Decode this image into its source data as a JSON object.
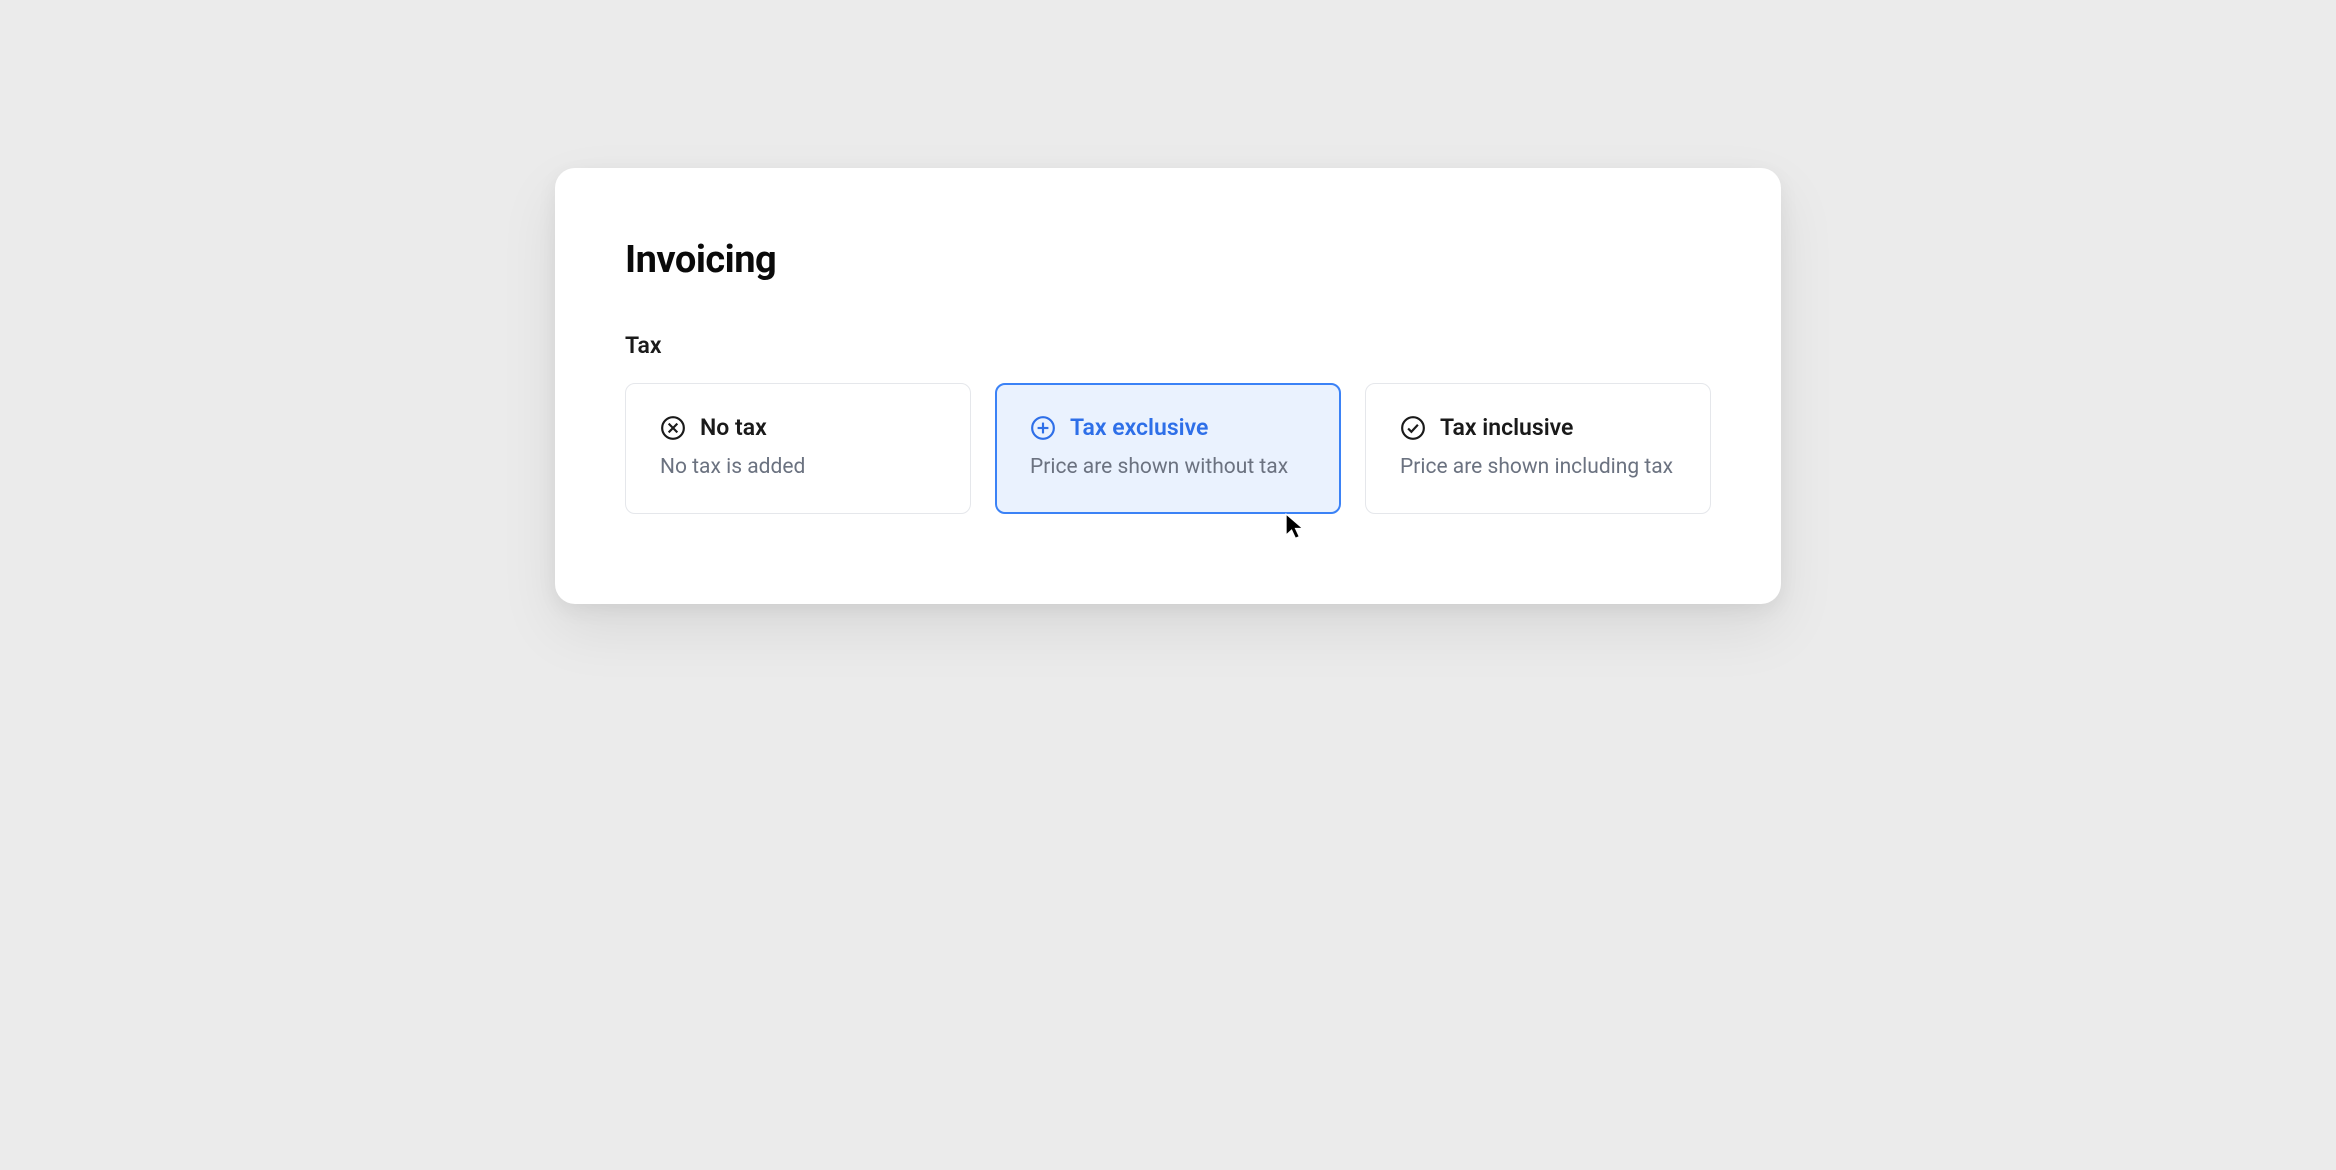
{
  "page": {
    "title": "Invoicing"
  },
  "tax": {
    "section_title": "Tax",
    "selected": 1,
    "options": [
      {
        "icon": "cross-circle",
        "title": "No tax",
        "description": "No tax is added"
      },
      {
        "icon": "plus-circle",
        "title": "Tax exclusive",
        "description": "Price are shown without tax"
      },
      {
        "icon": "check-circle",
        "title": "Tax inclusive",
        "description": "Price are shown including tax"
      }
    ]
  }
}
